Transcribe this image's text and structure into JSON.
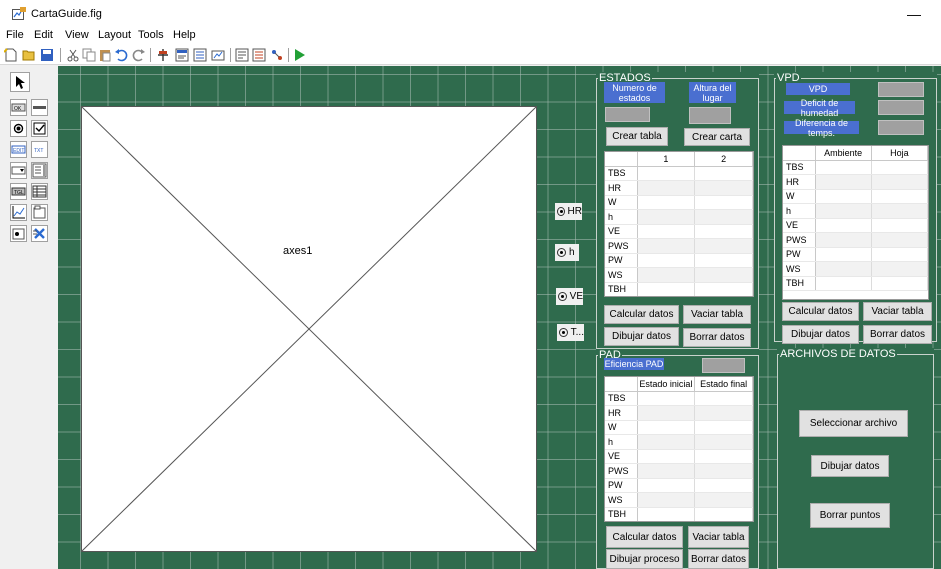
{
  "window": {
    "title": "CartaGuide.fig",
    "minimize": "—"
  },
  "menu": [
    "File",
    "Edit",
    "View",
    "Layout",
    "Tools",
    "Help"
  ],
  "axes": {
    "label": "axes1"
  },
  "radios": [
    "HR",
    "h",
    "VE",
    "T..."
  ],
  "estados": {
    "title": "ESTADOS",
    "num_label": "Numero de estados",
    "altura_label": "Altura del lugar",
    "crear_tabla": "Crear tabla",
    "crear_carta": "Crear carta",
    "columns": [
      "",
      "1",
      "2"
    ],
    "rows": [
      "TBS",
      "HR",
      "W",
      "h",
      "VE",
      "PWS",
      "PW",
      "WS",
      "TBH"
    ],
    "calcular": "Calcular datos",
    "vaciar": "Vaciar tabla",
    "dibujar": "Dibujar datos",
    "borrar": "Borrar datos"
  },
  "vpd": {
    "title": "VPD",
    "vpd_label": "VPD",
    "deficit_label": "Deficit de humedad",
    "diferencia_label": "Diferencia de temps.",
    "columns": [
      "",
      "Ambiente",
      "Hoja"
    ],
    "rows": [
      "TBS",
      "HR",
      "W",
      "h",
      "VE",
      "PWS",
      "PW",
      "WS",
      "TBH"
    ],
    "calcular": "Calcular datos",
    "vaciar": "Vaciar tabla",
    "dibujar": "Dibujar datos",
    "borrar": "Borrar datos"
  },
  "pad": {
    "title": "PAD",
    "eficiencia_label": "Eficiencia PAD",
    "columns": [
      "",
      "Estado inicial",
      "Estado final"
    ],
    "rows": [
      "TBS",
      "HR",
      "W",
      "h",
      "VE",
      "PWS",
      "PW",
      "WS",
      "TBH"
    ],
    "calcular": "Calcular datos",
    "vaciar": "Vaciar tabla",
    "dibujar": "Dibujar proceso",
    "borrar": "Borrar datos"
  },
  "archivos": {
    "title": "ARCHIVOS DE DATOS",
    "seleccionar": "Seleccionar archivo",
    "dibujar": "Dibujar datos",
    "borrar": "Borrar puntos"
  },
  "colors": {
    "canvas": "#2f6b4d",
    "label_blue": "#4a6fd0",
    "run_green": "#22a036"
  }
}
